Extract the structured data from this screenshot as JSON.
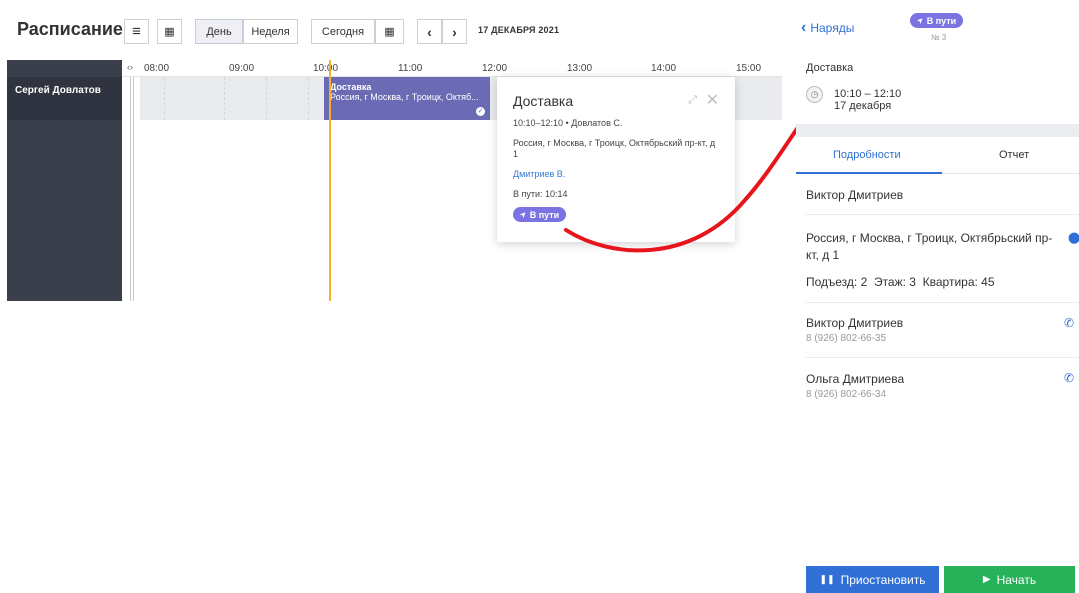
{
  "toolbar": {
    "title": "Расписание",
    "list_icon": "≡",
    "calendar_icon": "▦",
    "day_label": "День",
    "week_label": "Неделя",
    "today_label": "Сегодня",
    "today_cal_icon": "▦",
    "prev_icon": "‹",
    "next_icon": "›",
    "date": "17 ДЕКАБРЯ 2021"
  },
  "resource": {
    "name": "Сергей Довлатов",
    "collapse_icon": "‹›"
  },
  "timeline": {
    "ticks": [
      "08:00",
      "09:00",
      "10:00",
      "11:00",
      "12:00",
      "13:00",
      "14:00",
      "15:00"
    ]
  },
  "event": {
    "title": "Доставка",
    "subtitle": "Россия, г Москва, г Троицк, Октяб...",
    "check_icon": "✓"
  },
  "popup": {
    "title": "Доставка",
    "expand_icon": "⤢",
    "close_icon": "✕",
    "time": "10:10–12:10 • Довлатов С.",
    "address": "Россия, г Москва, г Троицк, Октябрьский пр-кт, д 1",
    "person": "Дмитриев В.",
    "status_text": "В пути: 10:14",
    "status_pill": "В пути",
    "status_icon": "➤"
  },
  "panel": {
    "back_label": "Наряды",
    "back_icon": "‹",
    "status_pill": "В пути",
    "status_icon": "➤",
    "order_no": "№ 3",
    "section_title": "Доставка",
    "clock_icon": "◷",
    "time_range": "10:10 – 12:10",
    "date": "17 декабря",
    "tabs": [
      {
        "label": "Подробности"
      },
      {
        "label": "Отчет"
      }
    ],
    "client_name": "Виктор Дмитриев",
    "address": "Россия, г Москва, г Троицк, Октябрьский пр-кт, д 1",
    "pin_icon": "⬤",
    "entrance": "Подъезд: 2",
    "floor": "Этаж: 3",
    "apartment": "Квартира: 45",
    "contacts": [
      {
        "name": "Виктор Дмитриев",
        "phone": "8 (926) 802-66-35"
      },
      {
        "name": "Ольга Дмитриева",
        "phone": "8 (926) 802-66-34"
      }
    ],
    "phone_icon": "✆",
    "pause_label": "Приостановить",
    "pause_icon": "❚❚",
    "start_label": "Начать",
    "start_icon": "▶"
  },
  "colors": {
    "accent": "#2f6fd6",
    "event": "#6b6bb5",
    "status_pill": "#7b73e2",
    "now_line": "#f0b429",
    "start_button": "#27b159",
    "annotation": "#e8141b"
  }
}
